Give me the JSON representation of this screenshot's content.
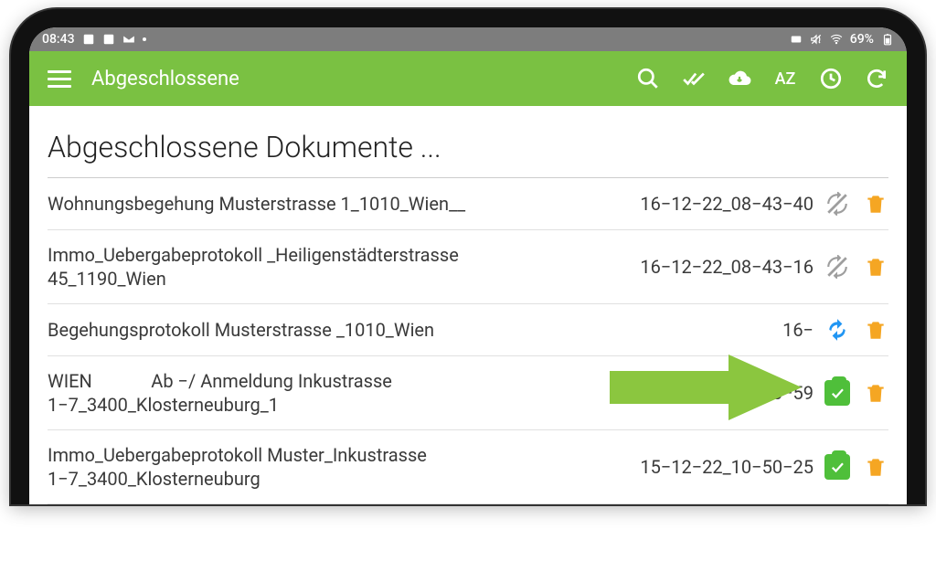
{
  "status": {
    "time": "08:43",
    "battery_text": "69%"
  },
  "appbar": {
    "title": "Abgeschlossene",
    "sort_label": "AZ"
  },
  "page": {
    "title": "Abgeschlossene Dokumente ..."
  },
  "documents": [
    {
      "name": "Wohnungsbegehung Musterstrasse 1_1010_Wien__",
      "date": "16−12−22_08−43−40",
      "status": "sync_disabled"
    },
    {
      "name": "Immo_Uebergabeprotokoll _Heiligenstädterstrasse 45_1190_Wien",
      "date": "16−12−22_08−43−16",
      "status": "sync_disabled"
    },
    {
      "name": "Begehungsprotokoll Musterstrasse _1010_Wien",
      "date": "16−",
      "status": "sync_active"
    },
    {
      "name": "WIEN             Ab −/ Anmeldung Inkustrasse 1−7_3400_Klosterneuburg_1",
      "date": "15−12−22_10−53−59",
      "status": "done"
    },
    {
      "name": "Immo_Uebergabeprotokoll Muster_Inkustrasse 1−7_3400_Klosterneuburg",
      "date": "15−12−22_10−50−25",
      "status": "done"
    }
  ],
  "icons": {
    "trash": "trash-icon",
    "sync_disabled": "sync-disabled-icon",
    "sync_active": "sync-icon",
    "done": "clipboard-check-icon"
  }
}
